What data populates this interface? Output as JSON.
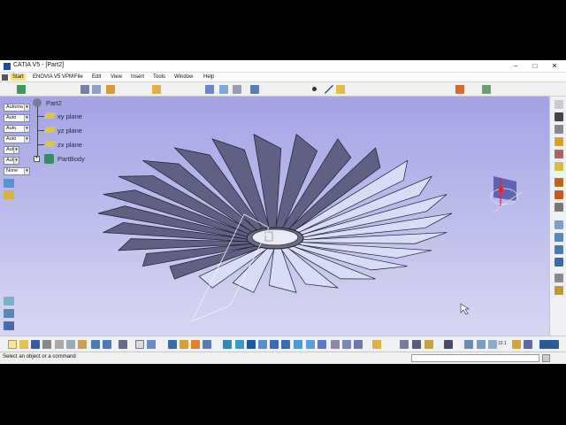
{
  "window": {
    "title": "CATIA V5 - [Part2]",
    "minimize_glyph": "–",
    "maximize_glyph": "□",
    "close_glyph": "✕"
  },
  "menubar": {
    "items": [
      "Start",
      "ENOVIA V5 VPM",
      "File",
      "Edit",
      "View",
      "Insert",
      "Tools",
      "Window",
      "Help"
    ]
  },
  "left_panel": {
    "combos": [
      "Automa",
      "Auto",
      "Auto",
      "Auto",
      "Aut",
      "Aut",
      "None"
    ]
  },
  "tree": {
    "root": "Part2",
    "items": [
      "xy plane",
      "yz plane",
      "zx plane",
      "PartBody"
    ]
  },
  "status": {
    "message": "Select an object or a command"
  },
  "toolbar_text": {
    "zoom_ratio": "10.1"
  },
  "colors": {
    "viewport_top": "#a3a3e6",
    "viewport_bottom": "#d7d7f1",
    "blade_fill": "#5f6082",
    "blade_light": "#d9dcf6"
  },
  "icons": {
    "compass": "compass-icon",
    "axis": "axis-system-icon",
    "sketch": "sketch-icon",
    "pad": "pad-icon",
    "plane": "plane-icon",
    "partbody": "partbody-icon"
  }
}
